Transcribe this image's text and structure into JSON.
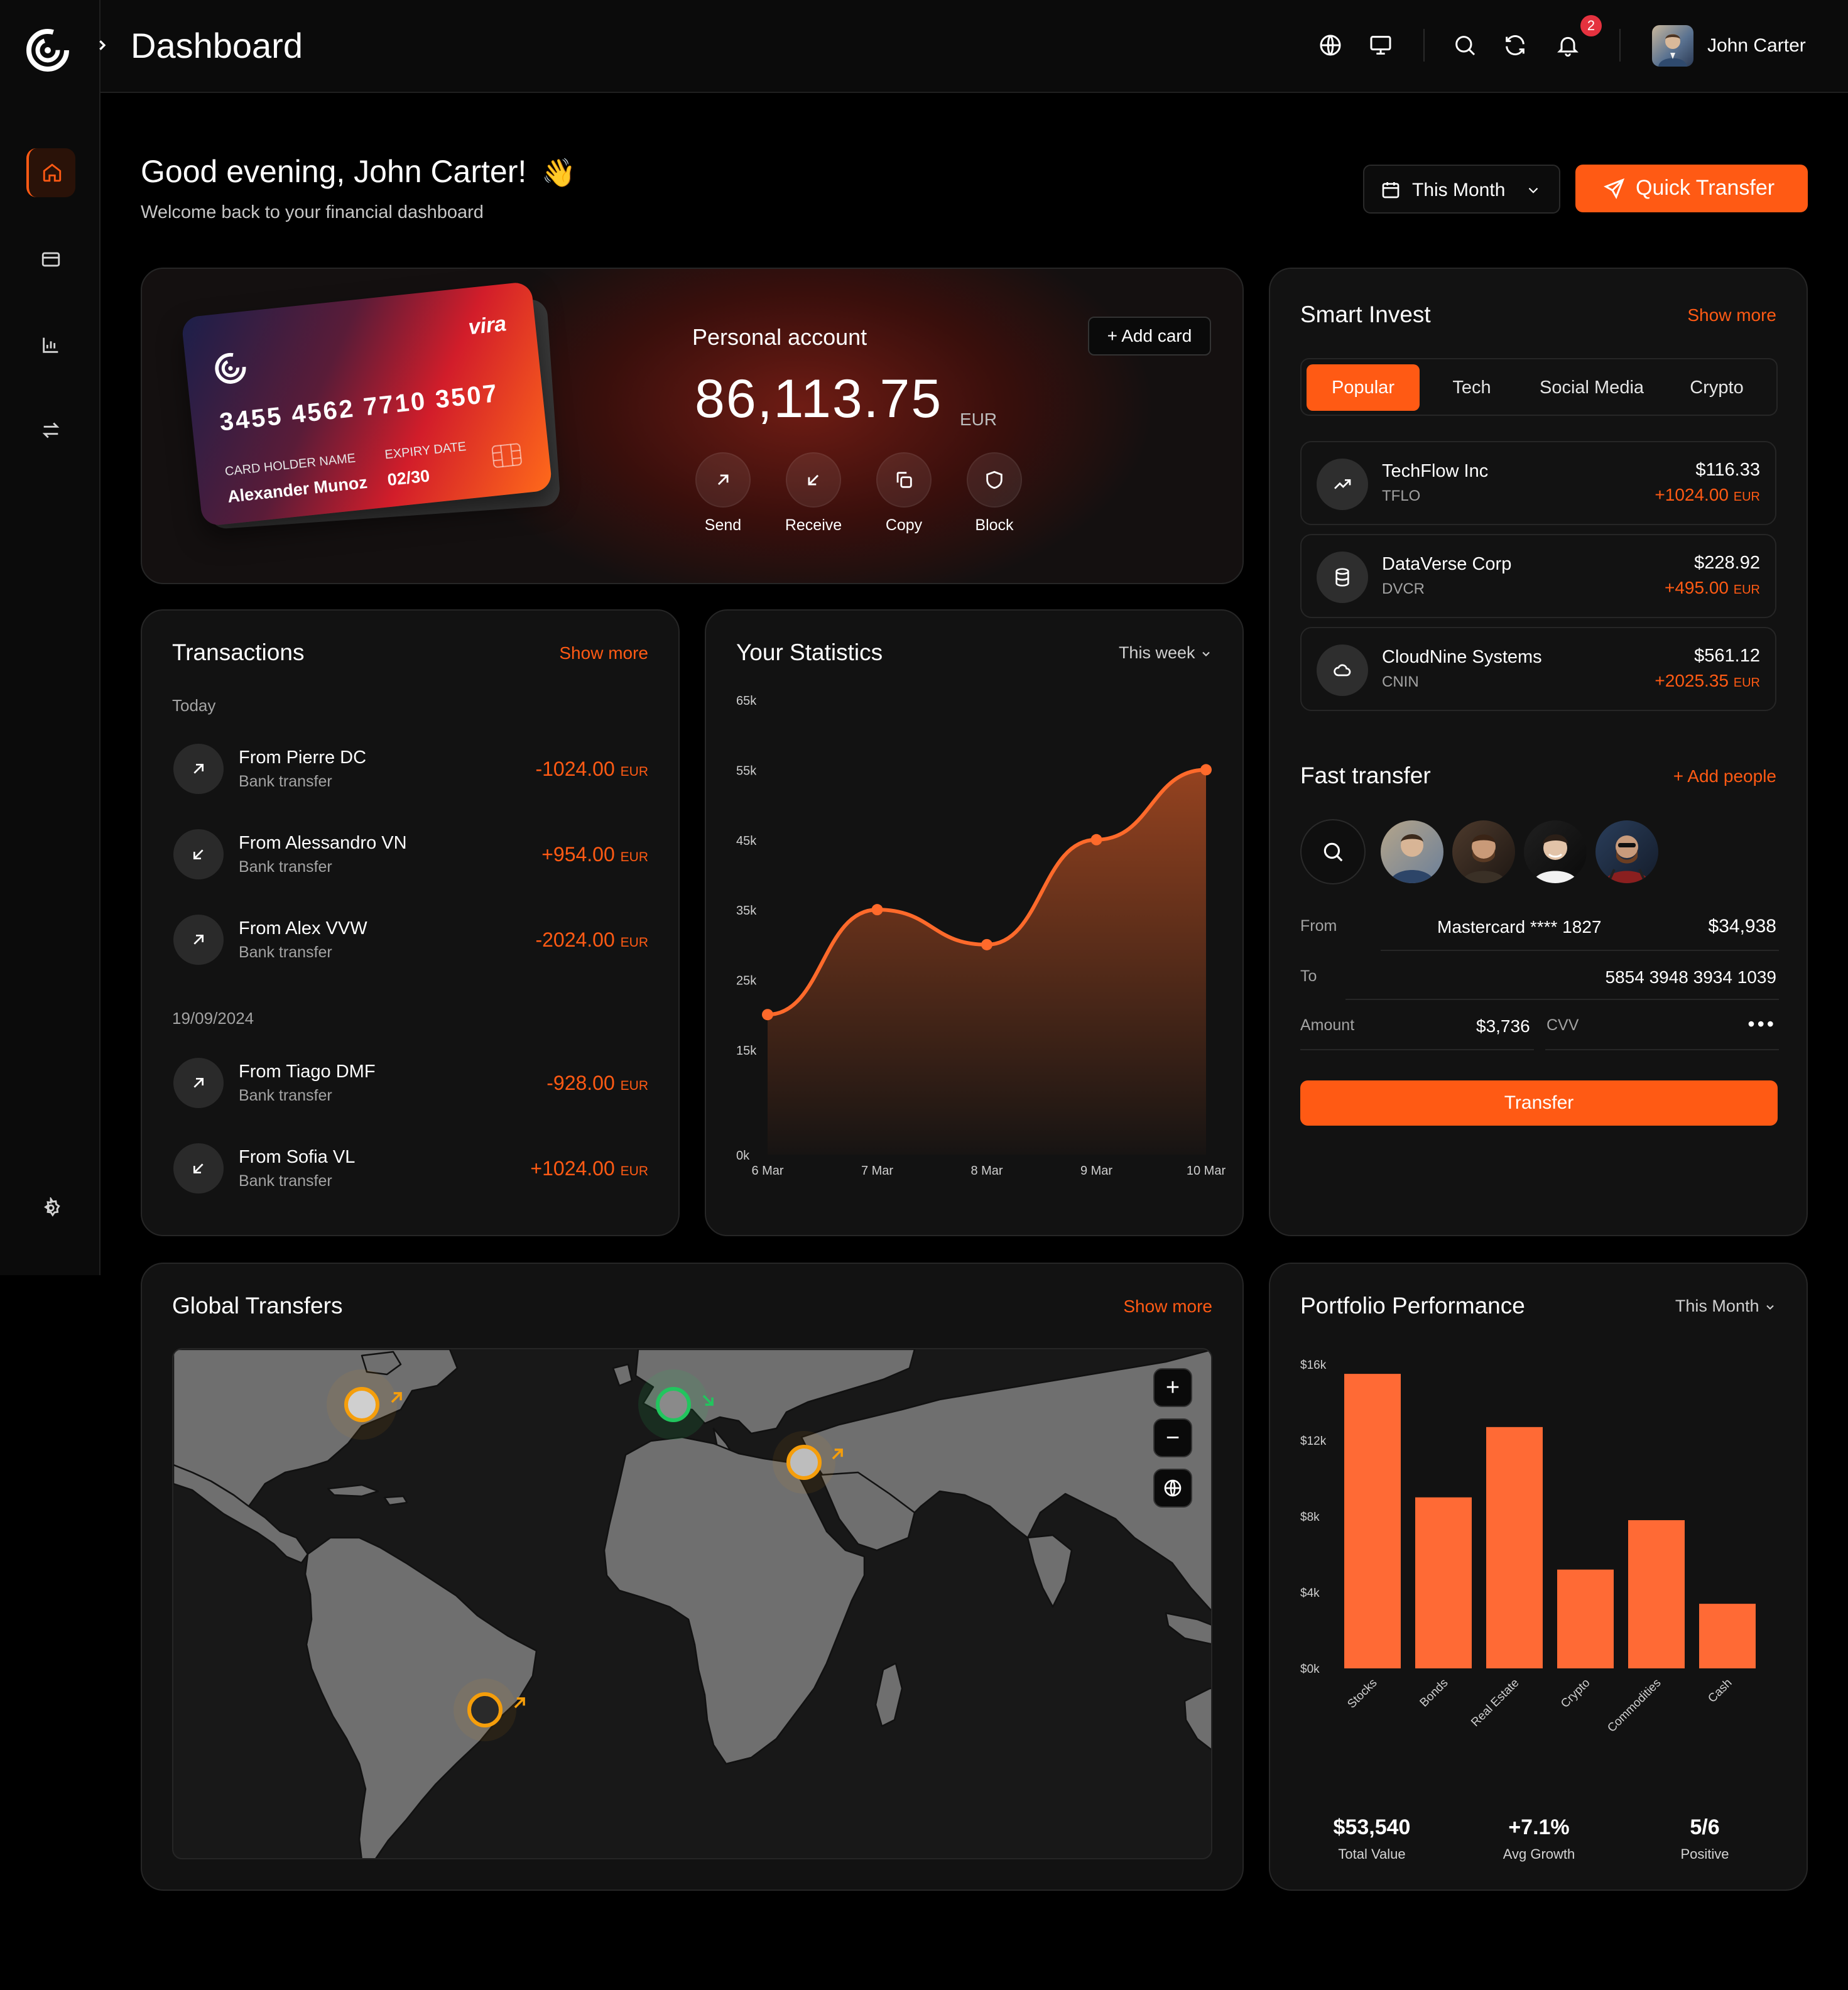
{
  "app": {
    "page_title": "Dashboard",
    "notifications_count": "2",
    "user_name": "John Carter"
  },
  "header": {
    "greeting": "Good evening, John Carter!",
    "greeting_emoji": "👋",
    "subtitle": "Welcome back to your financial dashboard",
    "period_select": "This Month",
    "quick_transfer": "Quick Transfer"
  },
  "card": {
    "brand": "vira",
    "number": "3455 4562 7710 3507",
    "holder_label": "CARD HOLDER NAME",
    "holder_name": "Alexander Munoz",
    "expiry_label": "EXPIRY DATE",
    "expiry": "02/30"
  },
  "account": {
    "title": "Personal account",
    "add_card": "+ Add card",
    "balance": "86,113.75",
    "currency": "EUR",
    "actions": [
      "Send",
      "Receive",
      "Copy",
      "Block"
    ]
  },
  "transactions": {
    "title": "Transactions",
    "show_more": "Show more",
    "groups": [
      {
        "date": "Today",
        "items": [
          {
            "name": "From Pierre DC",
            "type": "Bank transfer",
            "amount": "-1024.00",
            "currency": "EUR",
            "direction": "out"
          },
          {
            "name": "From Alessandro VN",
            "type": "Bank transfer",
            "amount": "+954.00",
            "currency": "EUR",
            "direction": "in"
          },
          {
            "name": "From Alex VVW",
            "type": "Bank transfer",
            "amount": "-2024.00",
            "currency": "EUR",
            "direction": "out"
          }
        ]
      },
      {
        "date": "19/09/2024",
        "items": [
          {
            "name": "From Tiago DMF",
            "type": "Bank transfer",
            "amount": "-928.00",
            "currency": "EUR",
            "direction": "out"
          },
          {
            "name": "From Sofia VL",
            "type": "Bank transfer",
            "amount": "+1024.00",
            "currency": "EUR",
            "direction": "in"
          }
        ]
      }
    ]
  },
  "statistics": {
    "title": "Your Statistics",
    "period": "This week"
  },
  "chart_data": [
    {
      "type": "area",
      "title": "Your Statistics",
      "x": [
        "6 Mar",
        "7 Mar",
        "8 Mar",
        "9 Mar",
        "10 Mar"
      ],
      "values": [
        20000,
        35000,
        30000,
        45000,
        55000
      ],
      "ylim": [
        0,
        65000
      ],
      "yticks": [
        "0k",
        "15k",
        "25k",
        "35k",
        "45k",
        "55k",
        "65k"
      ],
      "ytick_values": [
        0,
        15000,
        25000,
        35000,
        45000,
        55000,
        65000
      ],
      "color": "#ff6a2b",
      "grid": false
    },
    {
      "type": "bar",
      "title": "Portfolio Performance",
      "categories": [
        "Stocks",
        "Bonds",
        "Real Estate",
        "Crypto",
        "Commodities",
        "Cash"
      ],
      "values": [
        15500,
        9000,
        12700,
        5200,
        7800,
        3400
      ],
      "ylim": [
        0,
        16000
      ],
      "yticks": [
        "$0k",
        "$4k",
        "$8k",
        "$12k",
        "$16k"
      ],
      "ytick_values": [
        0,
        4000,
        8000,
        12000,
        16000
      ],
      "color": "#ff6a35",
      "grid": false
    }
  ],
  "smart_invest": {
    "title": "Smart Invest",
    "show_more": "Show more",
    "tabs": [
      "Popular",
      "Tech",
      "Social Media",
      "Crypto"
    ],
    "active_tab": "Popular",
    "items": [
      {
        "name": "TechFlow Inc",
        "ticker": "TFLO",
        "price": "$116.33",
        "change": "+1024.00",
        "currency": "EUR",
        "icon": "trending-up-icon"
      },
      {
        "name": "DataVerse Corp",
        "ticker": "DVCR",
        "price": "$228.92",
        "change": "+495.00",
        "currency": "EUR",
        "icon": "database-icon"
      },
      {
        "name": "CloudNine Systems",
        "ticker": "CNIN",
        "price": "$561.12",
        "change": "+2025.35",
        "currency": "EUR",
        "icon": "cloud-icon"
      }
    ]
  },
  "fast_transfer": {
    "title": "Fast transfer",
    "add_people": "+ Add people",
    "from_label": "From",
    "from_account": "Mastercard **** 1827",
    "from_balance": "$34,938",
    "to_label": "To",
    "to_account": "5854 3948 3934 1039",
    "amount_label": "Amount",
    "amount": "$3,736",
    "cvv_label": "CVV",
    "cvv_mask": "•••",
    "button": "Transfer"
  },
  "global_transfers": {
    "title": "Global Transfers",
    "show_more": "Show more",
    "zoom_in": "+",
    "zoom_out": "−"
  },
  "portfolio": {
    "title": "Portfolio Performance",
    "period": "This Month",
    "stats": [
      {
        "value": "$53,540",
        "label": "Total Value"
      },
      {
        "value": "+7.1%",
        "label": "Avg Growth"
      },
      {
        "value": "5/6",
        "label": "Positive"
      }
    ]
  },
  "colors": {
    "accent": "#ff5a14",
    "positive_marker": "#22c55e",
    "warning_marker": "#f59e0b",
    "badge": "#e5323f"
  }
}
